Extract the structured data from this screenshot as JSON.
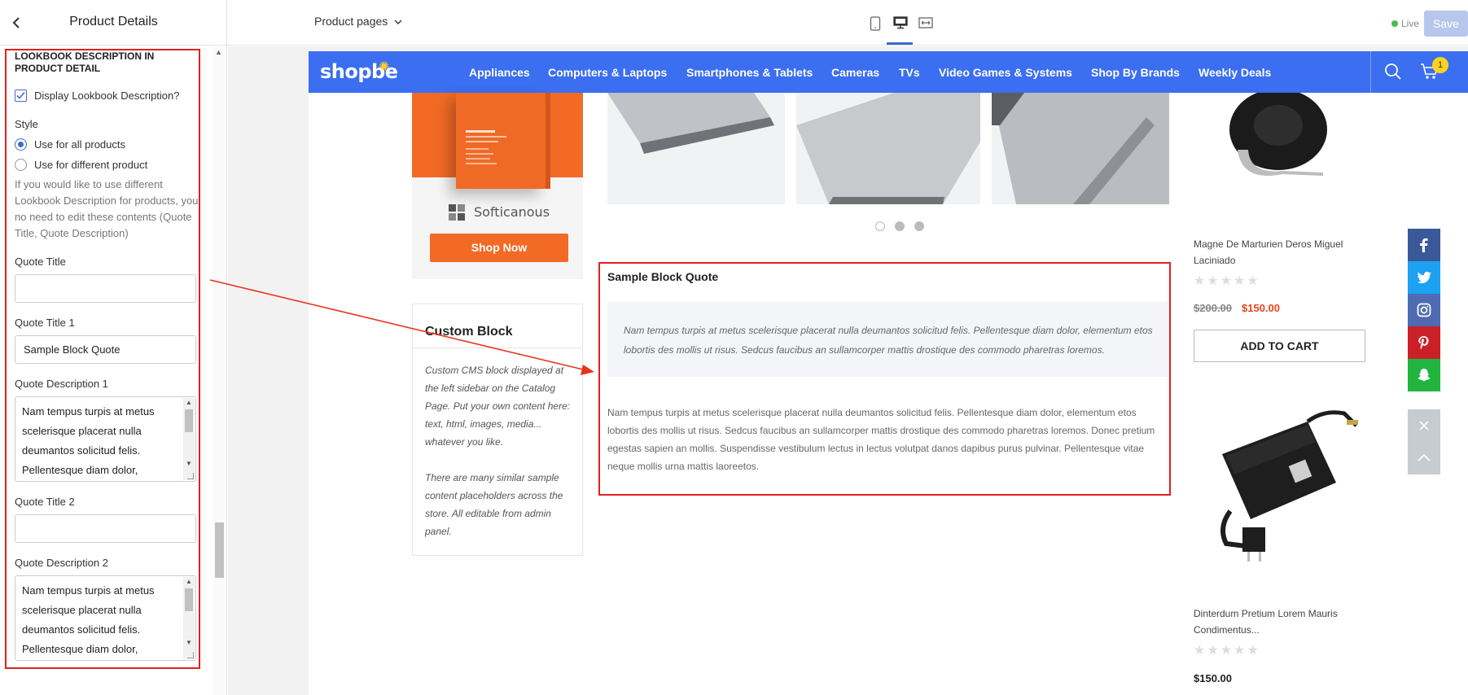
{
  "left_panel": {
    "title": "Product Details",
    "section_heading": "LOOKBOOK DESCRIPTION IN PRODUCT DETAIL",
    "display_checkbox_label": "Display Lookbook Description?",
    "style_label": "Style",
    "style_options": [
      "Use for all products",
      "Use for different product"
    ],
    "help_text": "If you would like to use different Lookbook Description for products, you no need to edit these contents (Quote Title, Quote Description)",
    "quote_title_label": "Quote Title",
    "quote_title_value": "",
    "quote_title1_label": "Quote Title 1",
    "quote_title1_value": "Sample Block Quote",
    "quote_desc1_label": "Quote Description 1",
    "quote_desc1_value": "Nam tempus turpis at metus scelerisque placerat nulla deumantos solicitud felis. Pellentesque diam dolor,",
    "quote_title2_label": "Quote Title 2",
    "quote_title2_value": "",
    "quote_desc2_label": "Quote Description 2",
    "quote_desc2_value": "Nam tempus turpis at metus scelerisque placerat nulla deumantos solicitud felis. Pellentesque diam dolor,"
  },
  "toolbar": {
    "pages_select": "Product pages",
    "live_label": "Live",
    "save_label": "Save"
  },
  "store": {
    "logo": "shopbe",
    "nav": [
      "Appliances",
      "Computers & Laptops",
      "Smartphones & Tablets",
      "Cameras",
      "TVs",
      "Video Games & Systems",
      "Shop By Brands",
      "Weekly Deals"
    ],
    "cart_count": "1",
    "banner_brand": "Softicanous",
    "banner_button": "Shop Now",
    "custom_block": {
      "title": "Custom Block",
      "text1": "Custom CMS block displayed at the left sidebar on the Catalog Page. Put your own content here: text, html, images, media... whatever you like.",
      "text2": "There are many similar sample content placeholders across the store. All editable from admin panel."
    },
    "quote": {
      "title": "Sample Block Quote",
      "italic": "Nam tempus turpis at metus scelerisque placerat nulla deumantos solicitud felis. Pellentesque diam dolor, elementum etos lobortis des mollis ut risus. Sedcus faucibus an sullamcorper mattis drostique des commodo pharetras loremos.",
      "body": "Nam tempus turpis at metus scelerisque placerat nulla deumantos solicitud felis. Pellentesque diam dolor, elementum etos lobortis des mollis ut risus. Sedcus faucibus an sullamcorper mattis drostique des commodo pharetras loremos. Donec pretium egestas sapien an mollis. Suspendisse vestibulum lectus in lectus volutpat danos dapibus purus pulvinar. Pellentesque vitae neque mollis urna mattis laoreetos."
    },
    "product1": {
      "name": "Magne De Marturien Deros Miguel Laciniado",
      "old_price": "$200.00",
      "new_price": "$150.00",
      "add_to_cart": "ADD TO CART"
    },
    "product2": {
      "name": "Dinterdum Pretium Lorem Mauris Condimentus...",
      "price": "$150.00"
    },
    "social_colors": {
      "facebook": "#3b5998",
      "twitter": "#1da1f2",
      "instagram": "#4e6bb4",
      "pinterest": "#cb2027",
      "snapchat": "#21b43f"
    },
    "accent": "#3b6ef0",
    "highlight": "#e02020"
  }
}
